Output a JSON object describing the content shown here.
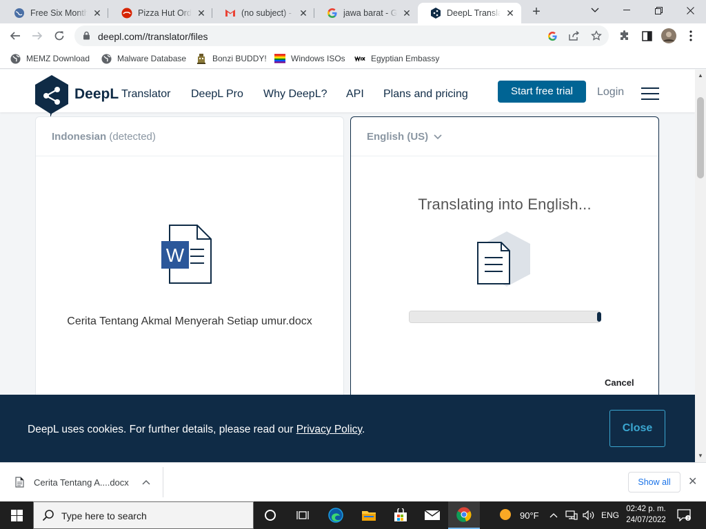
{
  "browser": {
    "tabs": [
      {
        "title": "Free Six Month Trial",
        "active": false
      },
      {
        "title": "Pizza Hut Order",
        "active": false
      },
      {
        "title": "(no subject) - ari",
        "active": false
      },
      {
        "title": "jawa barat - Google",
        "active": false
      },
      {
        "title": "DeepL Translate",
        "active": true
      }
    ],
    "url": "deepl.com//translator/files",
    "bookmarks": [
      {
        "label": "MEMZ Download",
        "icon": "globe-icon"
      },
      {
        "label": "Malware Database",
        "icon": "globe-icon"
      },
      {
        "label": "Bonzi BUDDY!",
        "icon": "bonzi-icon"
      },
      {
        "label": "Windows ISOs",
        "icon": "rainbow-flag-icon"
      },
      {
        "label": "Egyptian Embassy",
        "icon": "wix-icon"
      }
    ]
  },
  "site": {
    "brand": "DeepL",
    "brand_suffix": "Translator",
    "nav": [
      "DeepL Pro",
      "Why DeepL?",
      "API",
      "Plans and pricing"
    ],
    "trial_button": "Start free trial",
    "login": "Login"
  },
  "source": {
    "language": "Indonesian",
    "detected": "(detected)",
    "filename": "Cerita Tentang Akmal Menyerah Setiap umur.docx"
  },
  "target": {
    "language": "English (US)",
    "status": "Translating into English...",
    "progress": 0.99,
    "cancel": "Cancel"
  },
  "cookie": {
    "text": "DeepL uses cookies. For further details, please read our ",
    "link": "Privacy Policy",
    "end": ".",
    "close": "Close"
  },
  "download": {
    "filename": "Cerita Tentang A....docx",
    "show_all": "Show all"
  },
  "taskbar": {
    "search_placeholder": "Type here to search",
    "weather": "90°F",
    "language": "ENG",
    "time": "02:42 p. m.",
    "date": "24/07/2022"
  },
  "colors": {
    "brand_navy": "#0f2b46",
    "trial_blue": "#006494",
    "cookie_accent": "#3ba7d1",
    "word_blue": "#2b579a"
  }
}
